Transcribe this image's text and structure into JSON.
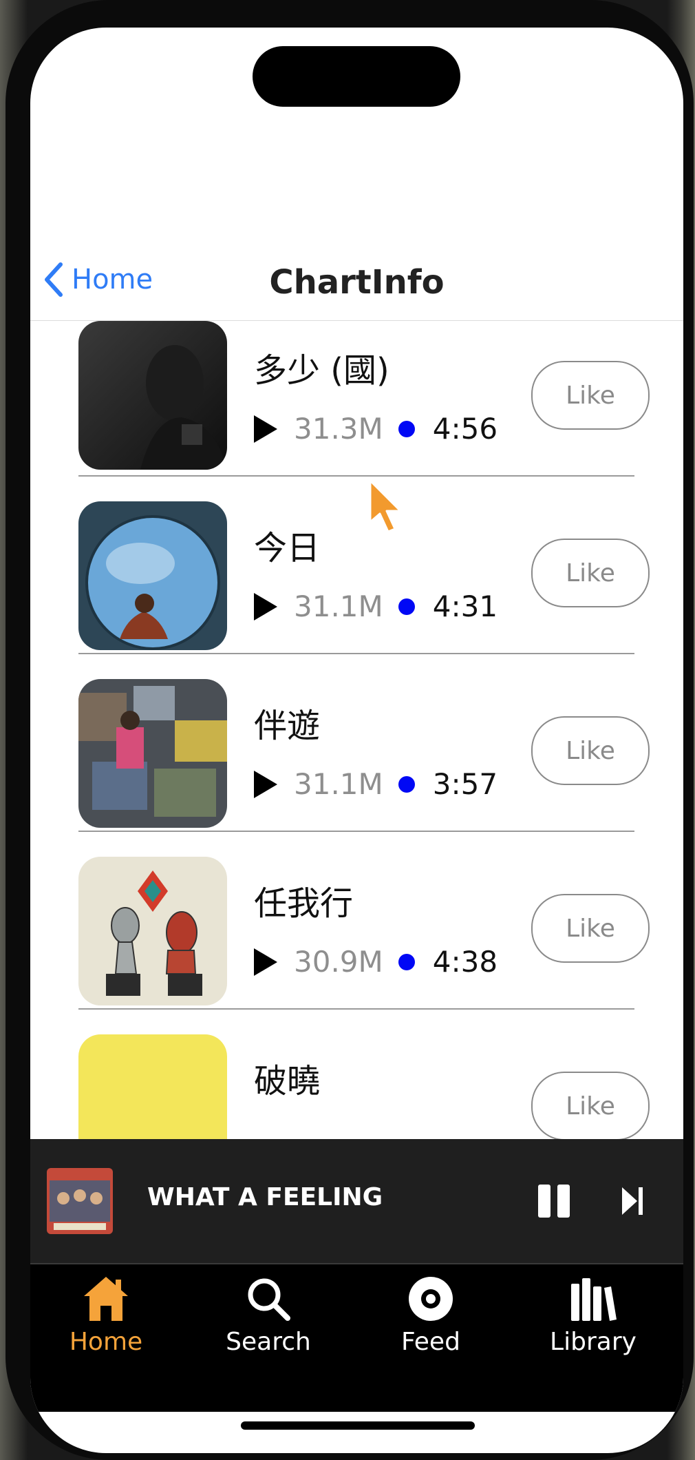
{
  "nav": {
    "back_label": "Home",
    "title": "ChartInfo"
  },
  "songs": [
    {
      "title": "多少 (國)",
      "plays": "31.3M",
      "duration": "4:56",
      "like_label": "Like"
    },
    {
      "title": "今日",
      "plays": "31.1M",
      "duration": "4:31",
      "like_label": "Like"
    },
    {
      "title": "伴遊",
      "plays": "31.1M",
      "duration": "3:57",
      "like_label": "Like"
    },
    {
      "title": "任我行",
      "plays": "30.9M",
      "duration": "4:38",
      "like_label": "Like"
    },
    {
      "title": "破曉",
      "plays": "",
      "duration": "",
      "like_label": "Like"
    }
  ],
  "now_playing": {
    "title": "WHAT A FEELING"
  },
  "tabs": [
    {
      "label": "Home",
      "icon": "house-icon",
      "active": true
    },
    {
      "label": "Search",
      "icon": "magnifier-icon",
      "active": false
    },
    {
      "label": "Feed",
      "icon": "disc-icon",
      "active": false
    },
    {
      "label": "Library",
      "icon": "library-icon",
      "active": false
    }
  ],
  "colors": {
    "accent": "#f5a33a",
    "link": "#2f7cf6",
    "dot": "#0008f5"
  }
}
